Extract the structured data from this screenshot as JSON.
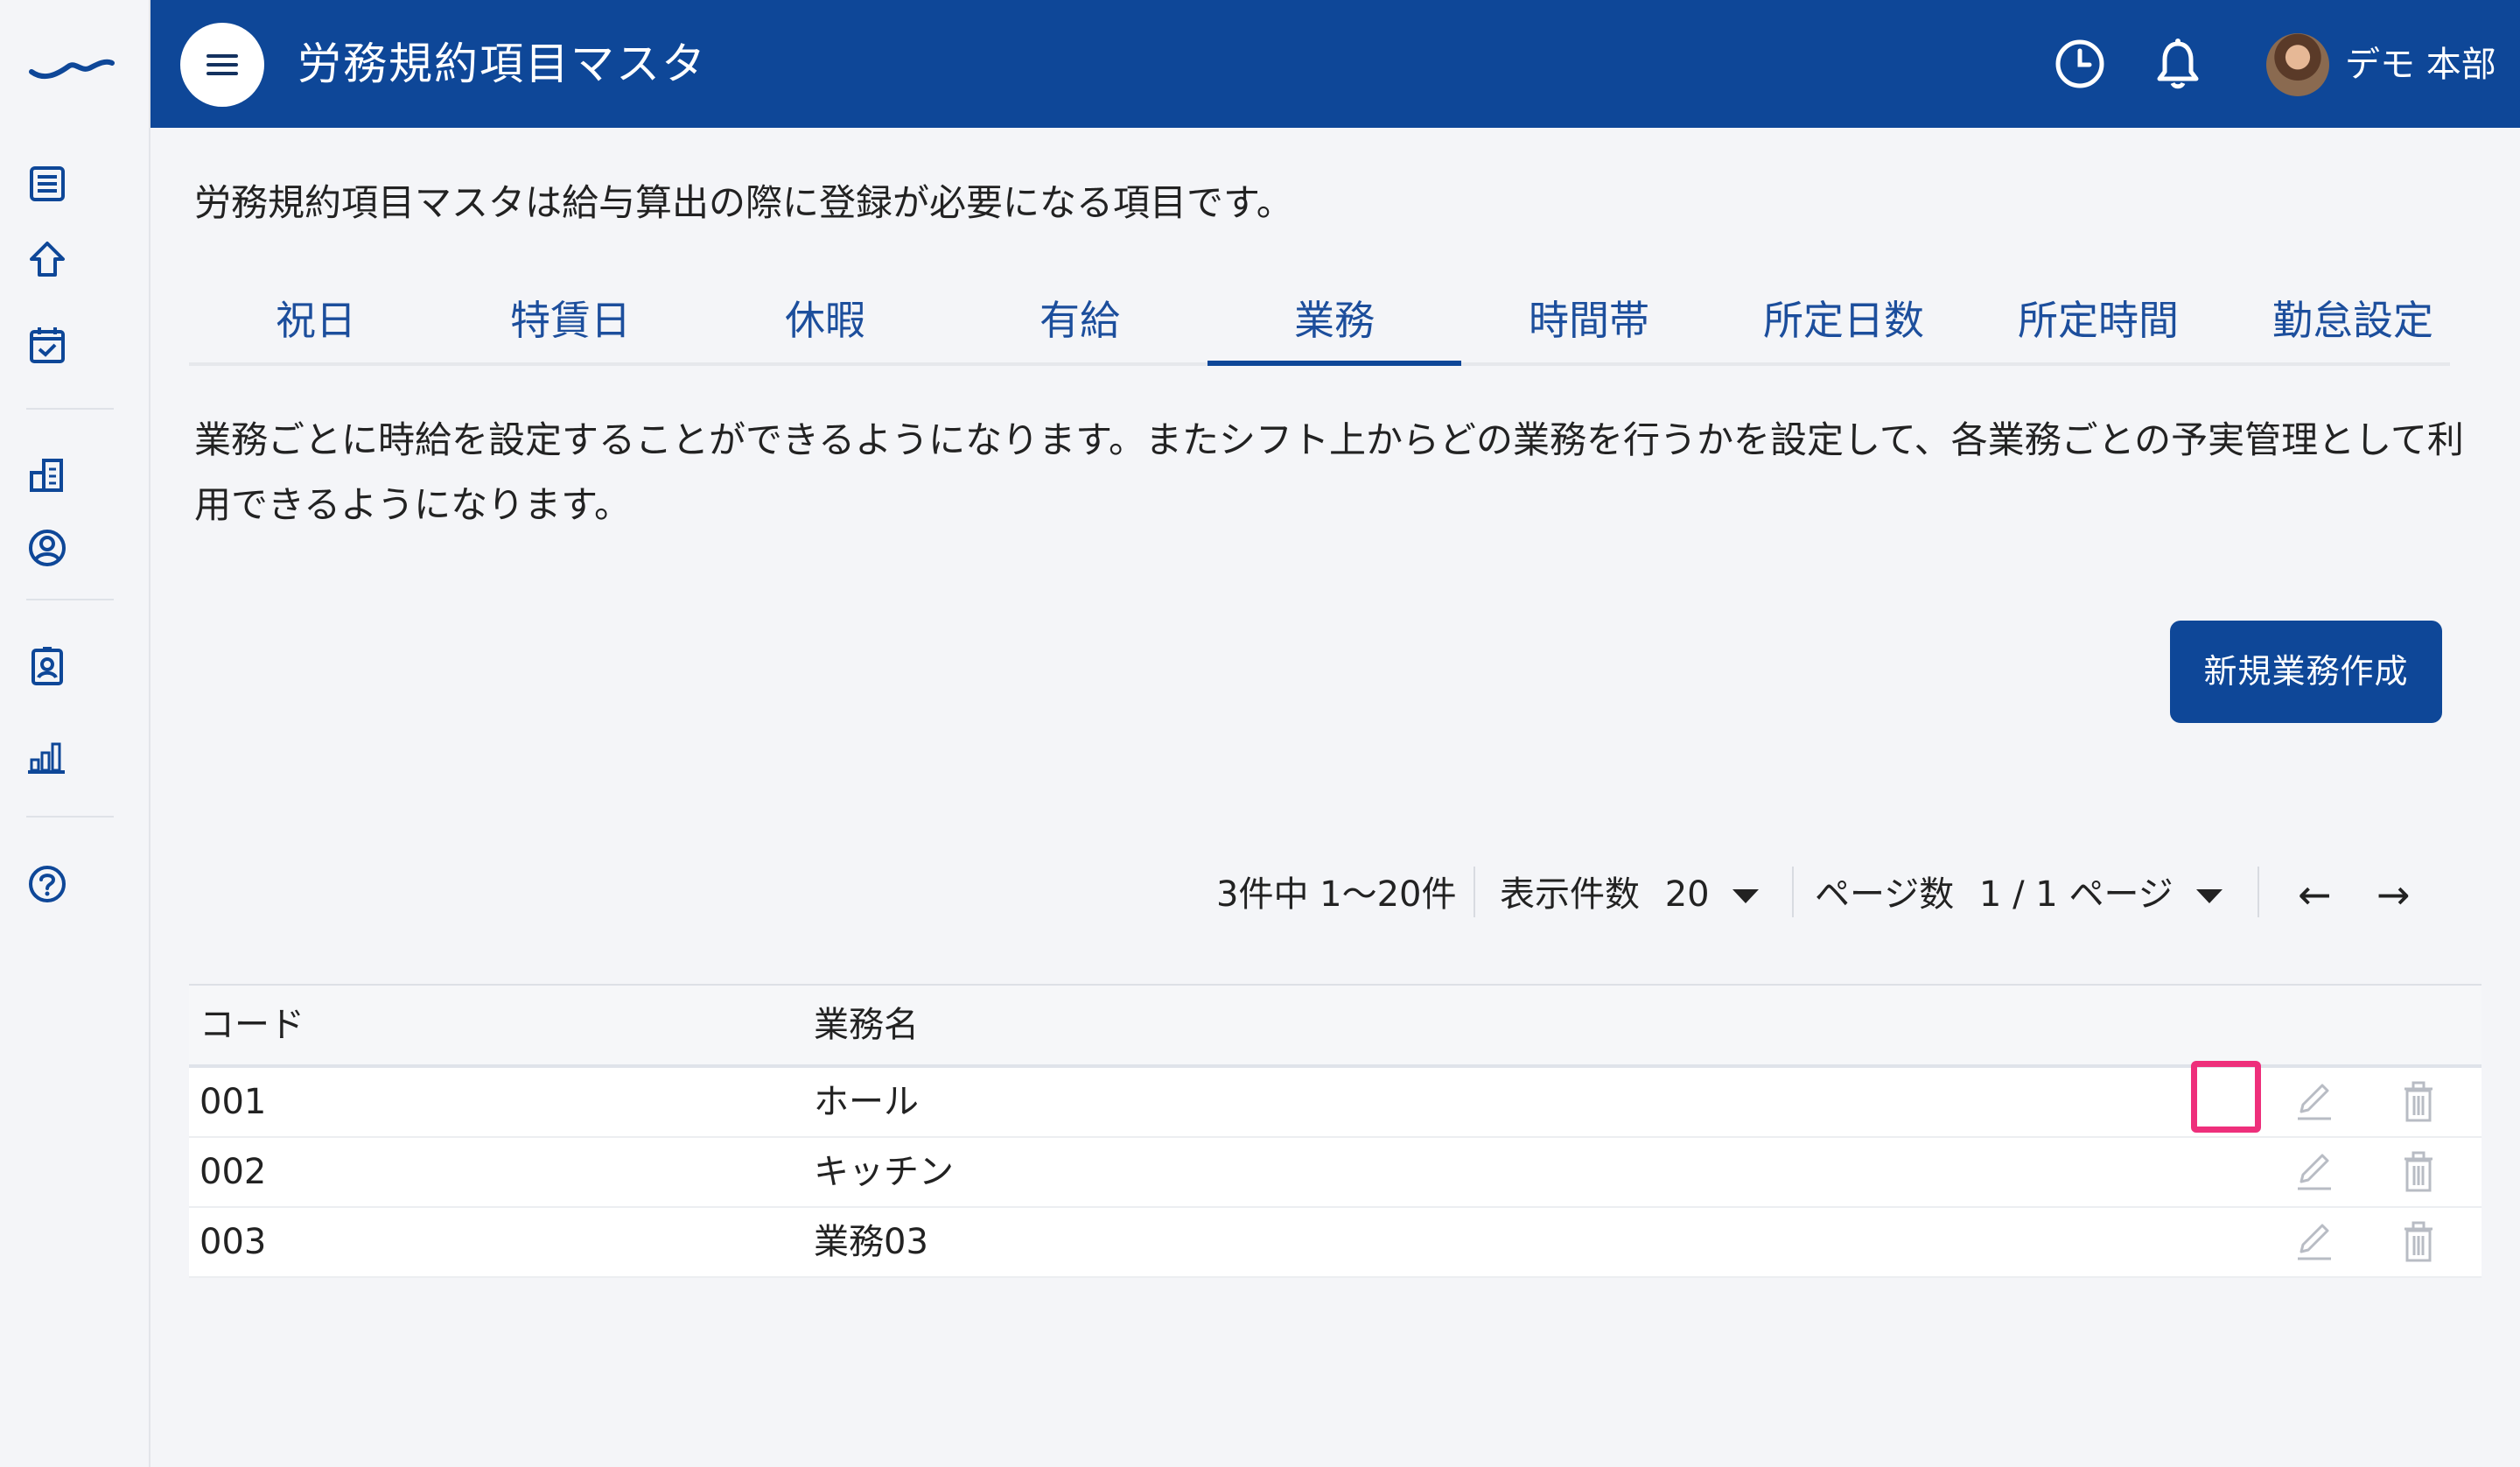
{
  "header": {
    "title": "労務規約項目マスタ",
    "user_name": "デモ 本部"
  },
  "intro": "労務規約項目マスタは給与算出の際に登録が必要になる項目です。",
  "tabs": [
    {
      "label": "祝日"
    },
    {
      "label": "特賃日"
    },
    {
      "label": "休暇"
    },
    {
      "label": "有給"
    },
    {
      "label": "業務",
      "active": true
    },
    {
      "label": "時間帯"
    },
    {
      "label": "所定日数"
    },
    {
      "label": "所定時間"
    },
    {
      "label": "勤怠設定"
    }
  ],
  "description": "業務ごとに時給を設定することができるようになります。またシフト上からどの業務を行うかを設定して、各業務ごとの予実管理として利用できるようになります。",
  "new_button": "新規業務作成",
  "pagination": {
    "summary": "3件中 1〜20件",
    "per_page_label": "表示件数",
    "per_page_value": "20",
    "page_label": "ページ数",
    "page_value": "1 / 1 ページ",
    "prev": "←",
    "next": "→"
  },
  "table": {
    "columns": [
      "コード",
      "業務名"
    ],
    "rows": [
      {
        "code": "001",
        "name": "ホール"
      },
      {
        "code": "002",
        "name": "キッチン"
      },
      {
        "code": "003",
        "name": "業務03"
      }
    ]
  },
  "colors": {
    "header_bg": "#0e4798",
    "tab_text": "#1c4e9c",
    "highlight": "#ee2f7b"
  },
  "icons": [
    "logo-icon",
    "list-icon",
    "home-icon",
    "calendar-icon",
    "building-icon",
    "user-circle-icon",
    "id-card-icon",
    "bar-chart-icon",
    "help-icon",
    "menu-icon",
    "clock-icon",
    "bell-icon",
    "edit-icon",
    "trash-icon"
  ]
}
